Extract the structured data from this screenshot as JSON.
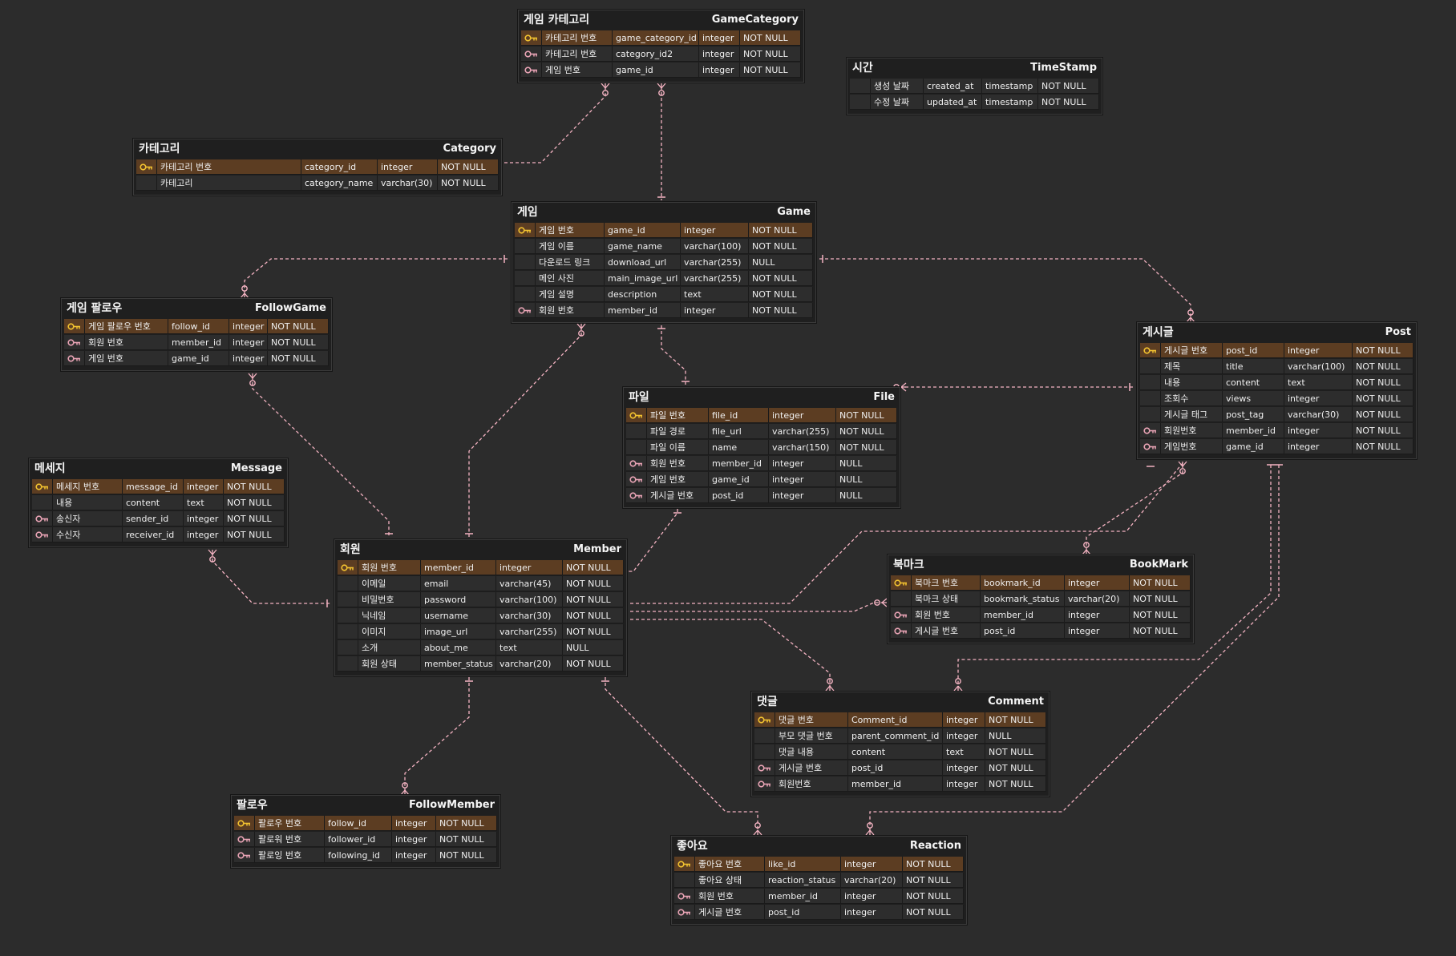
{
  "icons": {
    "pk": "primary-key-icon",
    "fk": "foreign-key-icon"
  },
  "colors": {
    "background": "#2c2c2c",
    "pk_row": "#5c3d22",
    "row": "#2d2d2d",
    "pk_icon": "#f2c230",
    "fk_icon": "#e8a3b4",
    "link": "#f4b3c2"
  },
  "entities": [
    {
      "id": "gamecategory",
      "ko": "게임 카테고리",
      "en": "GameCategory",
      "rows": [
        {
          "key": "pk",
          "ko": "카테고리 번호",
          "col": "game_category_id",
          "type": "integer",
          "null": "NOT NULL"
        },
        {
          "key": "fk",
          "ko": "카테고리 번호",
          "col": "category_id2",
          "type": "integer",
          "null": "NOT NULL"
        },
        {
          "key": "fk",
          "ko": "게임 번호",
          "col": "game_id",
          "type": "integer",
          "null": "NOT NULL"
        }
      ]
    },
    {
      "id": "timestamp",
      "ko": "시간",
      "en": "TimeStamp",
      "rows": [
        {
          "key": "",
          "ko": "생성 날짜",
          "col": "created_at",
          "type": "timestamp",
          "null": "NOT NULL"
        },
        {
          "key": "",
          "ko": "수정 날짜",
          "col": "updated_at",
          "type": "timestamp",
          "null": "NOT NULL"
        }
      ]
    },
    {
      "id": "category",
      "ko": "카테고리",
      "en": "Category",
      "rows": [
        {
          "key": "pk",
          "ko": "카테고리 번호",
          "col": "category_id",
          "type": "integer",
          "null": "NOT NULL"
        },
        {
          "key": "",
          "ko": "카테고리",
          "col": "category_name",
          "type": "varchar(30)",
          "null": "NOT NULL"
        }
      ]
    },
    {
      "id": "game",
      "ko": "게임",
      "en": "Game",
      "rows": [
        {
          "key": "pk",
          "ko": "게임 번호",
          "col": "game_id",
          "type": "integer",
          "null": "NOT NULL"
        },
        {
          "key": "",
          "ko": "게임 이름",
          "col": "game_name",
          "type": "varchar(100)",
          "null": "NOT NULL"
        },
        {
          "key": "",
          "ko": "다운로드 링크",
          "col": "download_url",
          "type": "varchar(255)",
          "null": "NULL"
        },
        {
          "key": "",
          "ko": "메인 사진",
          "col": "main_image_url",
          "type": "varchar(255)",
          "null": "NOT NULL"
        },
        {
          "key": "",
          "ko": "게임 설명",
          "col": "description",
          "type": "text",
          "null": "NOT NULL"
        },
        {
          "key": "fk",
          "ko": "회원 번호",
          "col": "member_id",
          "type": "integer",
          "null": "NOT NULL"
        }
      ]
    },
    {
      "id": "followgame",
      "ko": "게임 팔로우",
      "en": "FollowGame",
      "rows": [
        {
          "key": "pk",
          "ko": "게임 팔로우 번호",
          "col": "follow_id",
          "type": "integer",
          "null": "NOT NULL"
        },
        {
          "key": "fk",
          "ko": "회원 번호",
          "col": "member_id",
          "type": "integer",
          "null": "NOT NULL"
        },
        {
          "key": "fk",
          "ko": "게임 번호",
          "col": "game_id",
          "type": "integer",
          "null": "NOT NULL"
        }
      ]
    },
    {
      "id": "post",
      "ko": "게시글",
      "en": "Post",
      "rows": [
        {
          "key": "pk",
          "ko": "게시글 번호",
          "col": "post_id",
          "type": "integer",
          "null": "NOT NULL"
        },
        {
          "key": "",
          "ko": "제목",
          "col": "title",
          "type": "varchar(100)",
          "null": "NOT NULL"
        },
        {
          "key": "",
          "ko": "내용",
          "col": "content",
          "type": "text",
          "null": "NOT NULL"
        },
        {
          "key": "",
          "ko": "조회수",
          "col": "views",
          "type": "integer",
          "null": "NOT NULL"
        },
        {
          "key": "",
          "ko": "게시글 태그",
          "col": "post_tag",
          "type": "varchar(30)",
          "null": "NOT NULL"
        },
        {
          "key": "fk",
          "ko": "회원번호",
          "col": "member_id",
          "type": "integer",
          "null": "NOT NULL"
        },
        {
          "key": "fk",
          "ko": "게임번호",
          "col": "game_id",
          "type": "integer",
          "null": "NOT NULL"
        }
      ]
    },
    {
      "id": "file",
      "ko": "파일",
      "en": "File",
      "rows": [
        {
          "key": "pk",
          "ko": "파일 번호",
          "col": "file_id",
          "type": "integer",
          "null": "NOT NULL"
        },
        {
          "key": "",
          "ko": "파일 경로",
          "col": "file_url",
          "type": "varchar(255)",
          "null": "NOT NULL"
        },
        {
          "key": "",
          "ko": "파일 이름",
          "col": "name",
          "type": "varchar(150)",
          "null": "NOT NULL"
        },
        {
          "key": "fk",
          "ko": "회원 번호",
          "col": "member_id",
          "type": "integer",
          "null": "NULL"
        },
        {
          "key": "fk",
          "ko": "게임 번호",
          "col": "game_id",
          "type": "integer",
          "null": "NULL"
        },
        {
          "key": "fk",
          "ko": "게시글 번호",
          "col": "post_id",
          "type": "integer",
          "null": "NULL"
        }
      ]
    },
    {
      "id": "message",
      "ko": "메세지",
      "en": "Message",
      "rows": [
        {
          "key": "pk",
          "ko": "메세지 번호",
          "col": "message_id",
          "type": "integer",
          "null": "NOT NULL"
        },
        {
          "key": "",
          "ko": "내용",
          "col": "content",
          "type": "text",
          "null": "NOT NULL"
        },
        {
          "key": "fk",
          "ko": "송신자",
          "col": "sender_id",
          "type": "integer",
          "null": "NOT NULL"
        },
        {
          "key": "fk",
          "ko": "수신자",
          "col": "receiver_id",
          "type": "integer",
          "null": "NOT NULL"
        }
      ]
    },
    {
      "id": "member",
      "ko": "회원",
      "en": "Member",
      "rows": [
        {
          "key": "pk",
          "ko": "회원 번호",
          "col": "member_id",
          "type": "integer",
          "null": "NOT NULL"
        },
        {
          "key": "",
          "ko": "이메일",
          "col": "email",
          "type": "varchar(45)",
          "null": "NOT NULL"
        },
        {
          "key": "",
          "ko": "비밀번호",
          "col": "password",
          "type": "varchar(100)",
          "null": "NOT NULL"
        },
        {
          "key": "",
          "ko": "닉네임",
          "col": "username",
          "type": "varchar(30)",
          "null": "NOT NULL"
        },
        {
          "key": "",
          "ko": "이미지",
          "col": "image_url",
          "type": "varchar(255)",
          "null": "NOT NULL"
        },
        {
          "key": "",
          "ko": "소개",
          "col": "about_me",
          "type": "text",
          "null": "NULL"
        },
        {
          "key": "",
          "ko": "회원 상태",
          "col": "member_status",
          "type": "varchar(20)",
          "null": "NOT NULL"
        }
      ]
    },
    {
      "id": "bookmark",
      "ko": "북마크",
      "en": "BookMark",
      "rows": [
        {
          "key": "pk",
          "ko": "북마크 번호",
          "col": "bookmark_id",
          "type": "integer",
          "null": "NOT NULL"
        },
        {
          "key": "",
          "ko": "북마크 상태",
          "col": "bookmark_status",
          "type": "varchar(20)",
          "null": "NOT NULL"
        },
        {
          "key": "fk",
          "ko": "회원 번호",
          "col": "member_id",
          "type": "integer",
          "null": "NOT NULL"
        },
        {
          "key": "fk",
          "ko": "게시글 번호",
          "col": "post_id",
          "type": "integer",
          "null": "NOT NULL"
        }
      ]
    },
    {
      "id": "comment",
      "ko": "댓글",
      "en": "Comment",
      "rows": [
        {
          "key": "pk",
          "ko": "댓글 번호",
          "col": "Comment_id",
          "type": "integer",
          "null": "NOT NULL"
        },
        {
          "key": "",
          "ko": "부모 댓글 번호",
          "col": "parent_comment_id",
          "type": "integer",
          "null": "NULL"
        },
        {
          "key": "",
          "ko": "댓글 내용",
          "col": "content",
          "type": "text",
          "null": "NOT NULL"
        },
        {
          "key": "fk",
          "ko": "게시글 번호",
          "col": "post_id",
          "type": "integer",
          "null": "NOT NULL"
        },
        {
          "key": "fk",
          "ko": "회원번호",
          "col": "member_id",
          "type": "integer",
          "null": "NOT NULL"
        }
      ]
    },
    {
      "id": "followmember",
      "ko": "팔로우",
      "en": "FollowMember",
      "rows": [
        {
          "key": "pk",
          "ko": "팔로우 번호",
          "col": "follow_id",
          "type": "integer",
          "null": "NOT NULL"
        },
        {
          "key": "fk",
          "ko": "팔로워 번호",
          "col": "follower_id",
          "type": "integer",
          "null": "NOT NULL"
        },
        {
          "key": "fk",
          "ko": "팔로잉 번호",
          "col": "following_id",
          "type": "integer",
          "null": "NOT NULL"
        }
      ]
    },
    {
      "id": "reaction",
      "ko": "좋아요",
      "en": "Reaction",
      "rows": [
        {
          "key": "pk",
          "ko": "좋아요 번호",
          "col": "like_id",
          "type": "integer",
          "null": "NOT NULL"
        },
        {
          "key": "",
          "ko": "좋아요 상태",
          "col": "reaction_status",
          "type": "varchar(20)",
          "null": "NOT NULL"
        },
        {
          "key": "fk",
          "ko": "회원 번호",
          "col": "member_id",
          "type": "integer",
          "null": "NOT NULL"
        },
        {
          "key": "fk",
          "ko": "게시글 번호",
          "col": "post_id",
          "type": "integer",
          "null": "NOT NULL"
        }
      ]
    }
  ]
}
